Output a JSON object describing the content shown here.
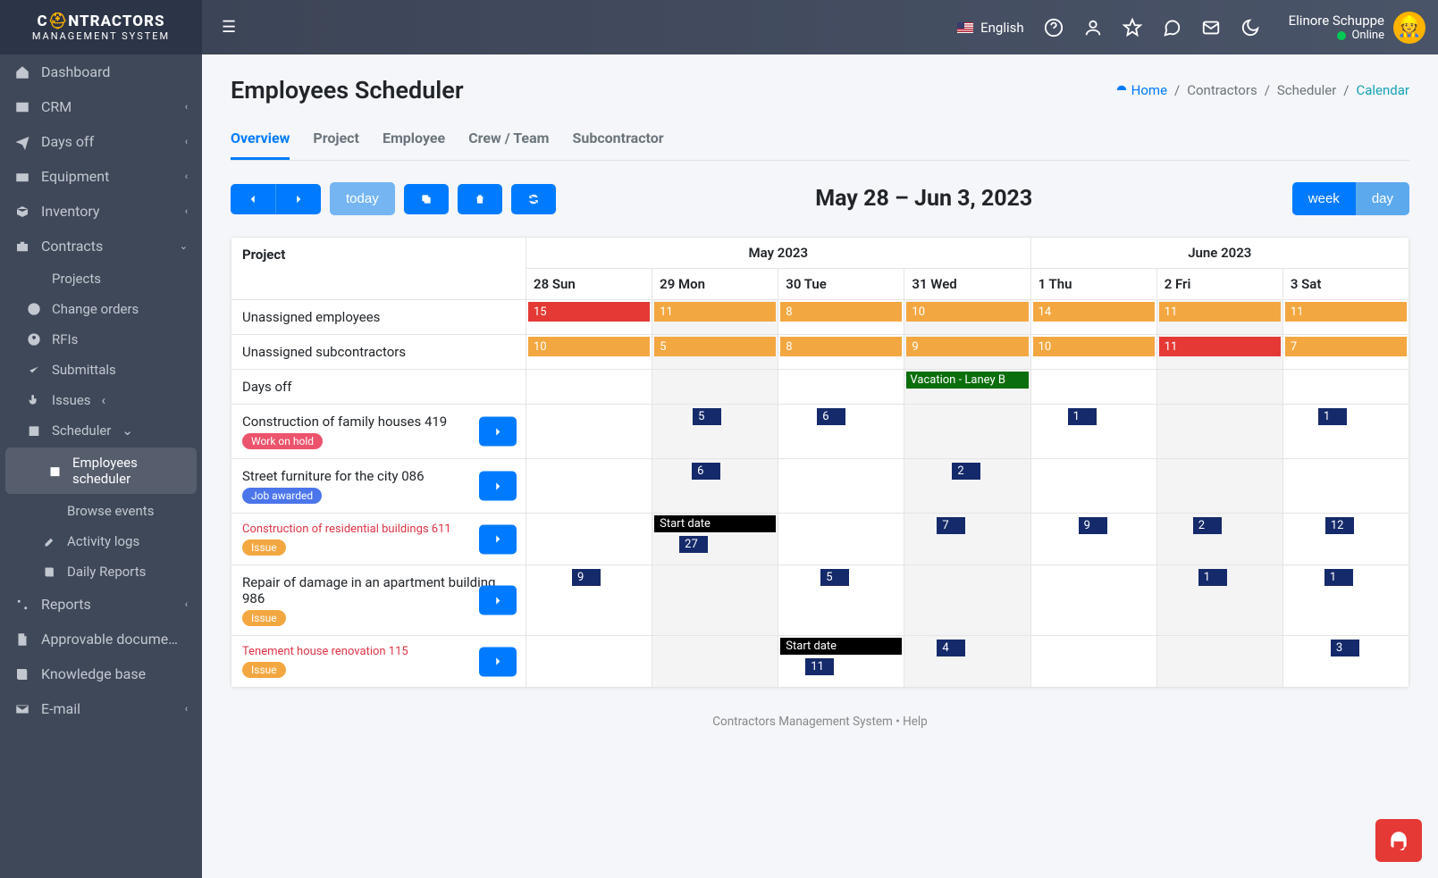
{
  "brand": {
    "line1_pre": "C",
    "line1_post": "NTRACTORS",
    "line2": "MANAGEMENT SYSTEM"
  },
  "topbar": {
    "language": "English",
    "user": {
      "name": "Elinore Schuppe",
      "status": "Online"
    }
  },
  "sidebar": {
    "items": [
      {
        "label": "Dashboard",
        "icon": "home"
      },
      {
        "label": "CRM",
        "icon": "id-card",
        "chev": true
      },
      {
        "label": "Days off",
        "icon": "plane",
        "chev": true
      },
      {
        "label": "Equipment",
        "icon": "boxes",
        "chev": true
      },
      {
        "label": "Inventory",
        "icon": "cubes",
        "chev": true
      },
      {
        "label": "Contracts",
        "icon": "briefcase",
        "chev": true,
        "open": true
      }
    ],
    "contracts_sub": [
      {
        "label": "Projects",
        "icon": "list"
      },
      {
        "label": "Change orders",
        "icon": "plus-circle"
      },
      {
        "label": "RFIs",
        "icon": "question-circle"
      },
      {
        "label": "Submittals",
        "icon": "check"
      },
      {
        "label": "Issues",
        "icon": "hand",
        "chev": true
      },
      {
        "label": "Scheduler",
        "icon": "calendar",
        "chev": true,
        "open": true
      }
    ],
    "scheduler_sub": [
      {
        "label": "Employees scheduler",
        "icon": "calendar",
        "active": true
      },
      {
        "label": "Browse events",
        "icon": "list-lines"
      },
      {
        "label": "Activity logs",
        "icon": "edit"
      },
      {
        "label": "Daily Reports",
        "icon": "book"
      }
    ],
    "after": [
      {
        "label": "Reports",
        "icon": "percent",
        "chev": true
      },
      {
        "label": "Approvable docume…",
        "icon": "file"
      },
      {
        "label": "Knowledge base",
        "icon": "book"
      },
      {
        "label": "E-mail",
        "icon": "envelope",
        "chev": true
      }
    ]
  },
  "page": {
    "title": "Employees Scheduler",
    "breadcrumb": {
      "home": "Home",
      "b1": "Contractors",
      "b2": "Scheduler",
      "b3": "Calendar"
    },
    "tabs": [
      "Overview",
      "Project",
      "Employee",
      "Crew / Team",
      "Subcontractor"
    ],
    "today_label": "today",
    "date_range": "May 28 – Jun 3, 2023",
    "view": {
      "week": "week",
      "day": "day"
    },
    "months": [
      "May 2023",
      "June 2023"
    ],
    "days": [
      "28 Sun",
      "29 Mon",
      "30 Tue",
      "31 Wed",
      "1 Thu",
      "2 Fri",
      "3 Sat"
    ],
    "project_col": "Project",
    "rows": {
      "r0": {
        "label": "Unassigned employees",
        "counts": [
          {
            "v": "15",
            "color": "red"
          },
          {
            "v": "11",
            "color": "orange"
          },
          {
            "v": "8",
            "color": "orange"
          },
          {
            "v": "10",
            "color": "orange"
          },
          {
            "v": "14",
            "color": "orange"
          },
          {
            "v": "11",
            "color": "orange"
          },
          {
            "v": "11",
            "color": "orange"
          }
        ]
      },
      "r1": {
        "label": "Unassigned subcontractors",
        "counts": [
          {
            "v": "10",
            "color": "orange"
          },
          {
            "v": "5",
            "color": "orange"
          },
          {
            "v": "8",
            "color": "orange"
          },
          {
            "v": "9",
            "color": "orange"
          },
          {
            "v": "10",
            "color": "orange"
          },
          {
            "v": "11",
            "color": "red"
          },
          {
            "v": "7",
            "color": "orange"
          }
        ]
      },
      "r2": {
        "label": "Days off",
        "event": {
          "day": 3,
          "text": "Vacation - Laney B"
        }
      },
      "r3": {
        "label": "Construction of family houses 419",
        "badge": {
          "text": "Work on hold",
          "color": "red"
        },
        "arrow": true,
        "blocks": [
          {
            "day": 1,
            "v": "5"
          },
          {
            "day": 2,
            "v": "6"
          },
          {
            "day": 4,
            "v": "1"
          },
          {
            "day": 6,
            "v": "1"
          }
        ]
      },
      "r4": {
        "label": "Street furniture for the city 086",
        "badge": {
          "text": "Job awarded",
          "color": "blue"
        },
        "arrow": true,
        "blocks": [
          {
            "day": 1,
            "v": "6"
          },
          {
            "day": 3,
            "v": "2"
          }
        ]
      },
      "r5": {
        "label": "Construction of residential buildings 611",
        "red": true,
        "badge": {
          "text": "Issue",
          "color": "orange"
        },
        "arrow": true,
        "start": {
          "day": 1,
          "text": "Start date",
          "below": "27"
        },
        "blocks": [
          {
            "day": 3,
            "v": "7"
          },
          {
            "day": 4,
            "v": "9"
          },
          {
            "day": 5,
            "v": "2"
          },
          {
            "day": 6,
            "v": "12"
          }
        ]
      },
      "r6": {
        "label": "Repair of damage in an apartment building 986",
        "badge": {
          "text": "Issue",
          "color": "orange"
        },
        "arrow": true,
        "blocks": [
          {
            "day": 0,
            "v": "9"
          },
          {
            "day": 2,
            "v": "5"
          },
          {
            "day": 5,
            "v": "1"
          },
          {
            "day": 6,
            "v": "1"
          }
        ]
      },
      "r7": {
        "label": "Tenement house renovation 115",
        "red": true,
        "badge": {
          "text": "Issue",
          "color": "orange"
        },
        "arrow": true,
        "start": {
          "day": 2,
          "text": "Start date",
          "below": "11"
        },
        "blocks": [
          {
            "day": 3,
            "v": "4"
          },
          {
            "day": 6,
            "v": "3"
          }
        ]
      }
    }
  },
  "footer": "Contractors Management System • Help"
}
